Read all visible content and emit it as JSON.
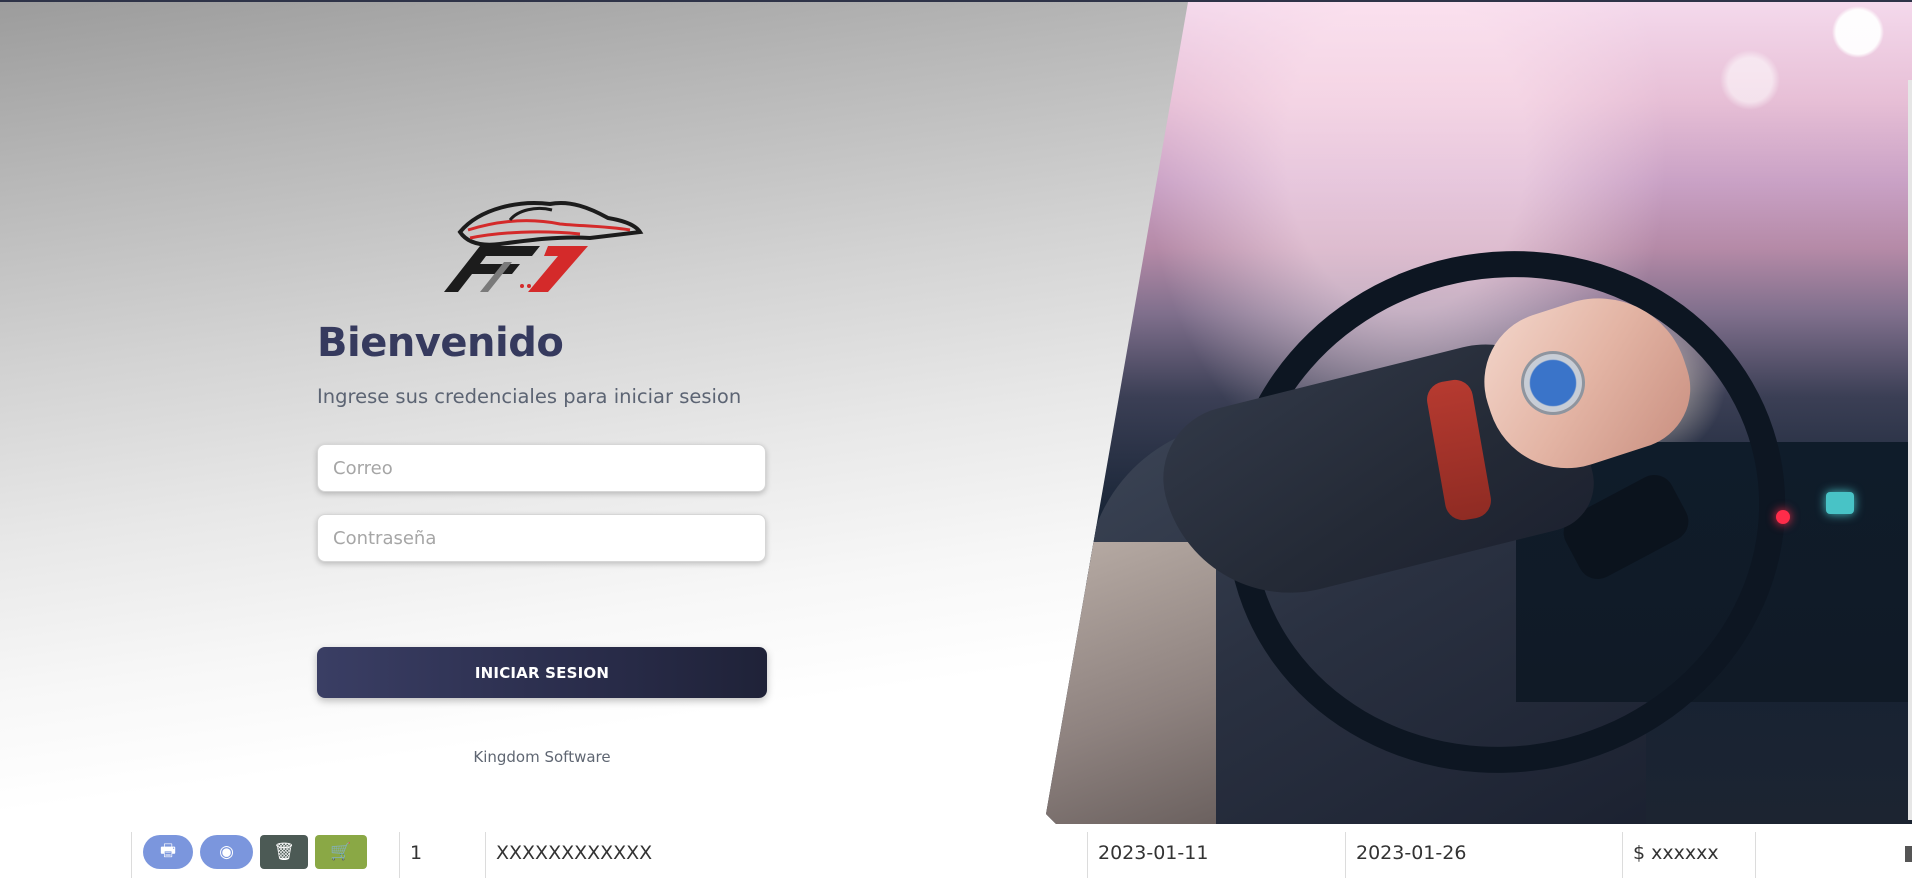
{
  "login": {
    "title": "Bienvenido",
    "subtitle": "Ingrese sus credenciales para iniciar sesion",
    "email_placeholder": "Correo",
    "password_placeholder": "Contraseña",
    "submit_label": "INICIAR SESION",
    "footer": "Kingdom Software"
  },
  "logo": {
    "brand_text": "F1",
    "icon": "race-car-logo"
  },
  "background_row": {
    "index": "1",
    "name": "XXXXXXXXXXXX",
    "date_start": "2023-01-11",
    "date_end": "2023-01-26",
    "amount": "$ xxxxxx",
    "actions": [
      {
        "icon": "print-icon",
        "glyph": "🖶"
      },
      {
        "icon": "eye-icon",
        "glyph": "◉"
      },
      {
        "icon": "trash-icon",
        "glyph": "🗑"
      },
      {
        "icon": "cart-icon",
        "glyph": "🛒"
      }
    ]
  },
  "colors": {
    "primary": "#363a5e",
    "button_dark": "#2b2e4d",
    "action_blue": "#7b96dd",
    "action_green": "#8aa845",
    "action_gray": "#4c5a55"
  }
}
